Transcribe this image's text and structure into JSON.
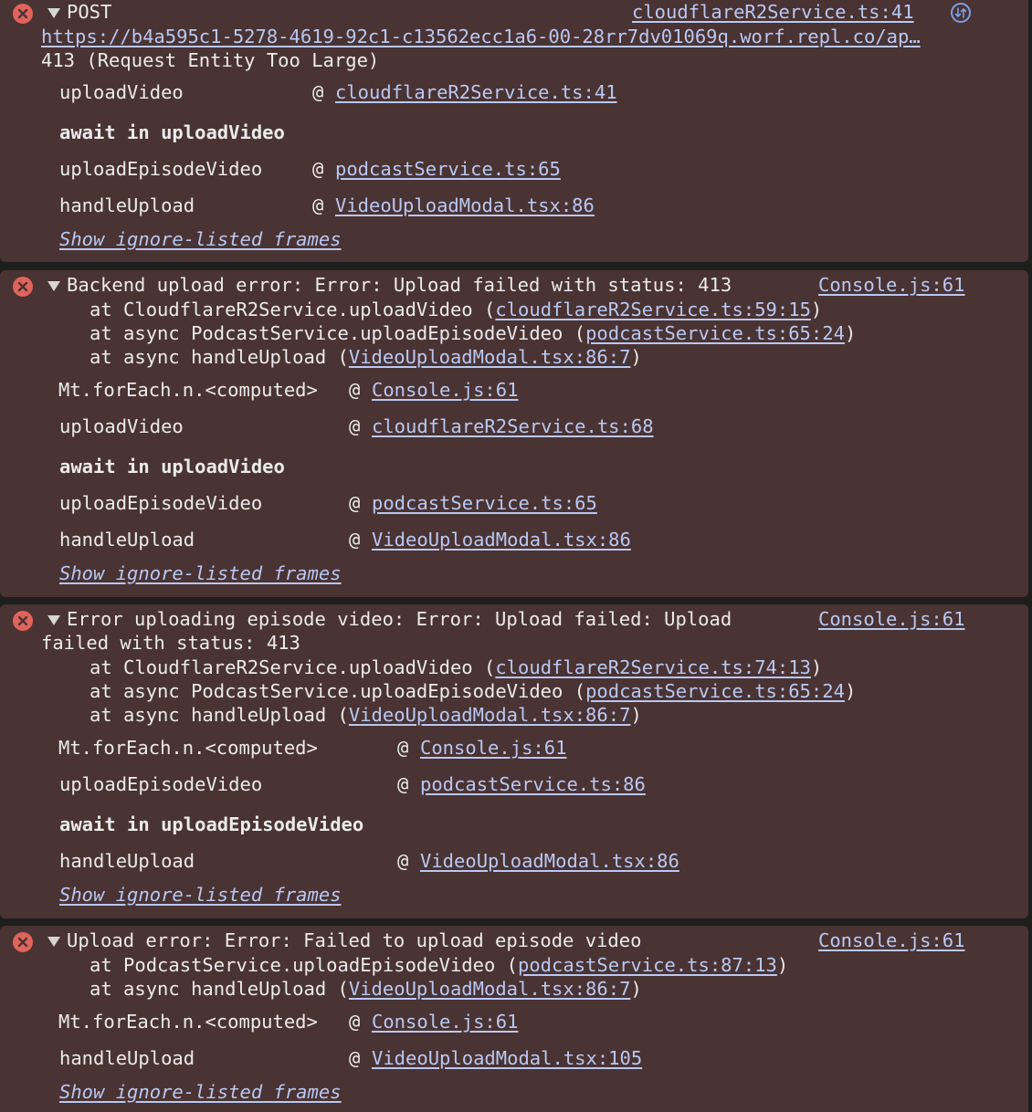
{
  "block1": {
    "method": "POST",
    "source": "cloudflareR2Service.ts:41",
    "url": "https://b4a595c1-5278-4619-92c1-c13562ecc1a6-00-28rr7dv01069q.worf.repl.co/ap…",
    "status": "413 (Request Entity Too Large)",
    "frames": [
      {
        "fn": "uploadVideo",
        "at": "@",
        "loc": "cloudflareR2Service.ts:41"
      },
      {
        "fn": "uploadEpisodeVideo",
        "at": "@",
        "loc": "podcastService.ts:65"
      },
      {
        "fn": "handleUpload",
        "at": "@",
        "loc": "VideoUploadModal.tsx:86"
      }
    ],
    "await_label": "await in uploadVideo",
    "show_frames": "Show ignore-listed frames"
  },
  "block2": {
    "message": "Backend upload error: Error: Upload failed with status: 413",
    "source": "Console.js:61",
    "stack": [
      {
        "prefix": "at CloudflareR2Service.uploadVideo (",
        "loc": "cloudflareR2Service.ts:59:15",
        "suffix": ")"
      },
      {
        "prefix": "at async PodcastService.uploadEpisodeVideo (",
        "loc": "podcastService.ts:65:24",
        "suffix": ")"
      },
      {
        "prefix": "at async handleUpload (",
        "loc": "VideoUploadModal.tsx:86:7",
        "suffix": ")"
      }
    ],
    "frames": [
      {
        "fn": "Mt.forEach.n.<computed>",
        "at": "@",
        "loc": "Console.js:61"
      },
      {
        "fn": "uploadVideo",
        "at": "@",
        "loc": "cloudflareR2Service.ts:68"
      },
      {
        "fn": "uploadEpisodeVideo",
        "at": "@",
        "loc": "podcastService.ts:65"
      },
      {
        "fn": "handleUpload",
        "at": "@",
        "loc": "VideoUploadModal.tsx:86"
      }
    ],
    "await_label": "await in uploadVideo",
    "show_frames": "Show ignore-listed frames"
  },
  "block3": {
    "message_line1": "Error uploading episode video: Error: Upload failed: Upload",
    "message_line2": "failed with status: 413",
    "source": "Console.js:61",
    "stack": [
      {
        "prefix": "at CloudflareR2Service.uploadVideo (",
        "loc": "cloudflareR2Service.ts:74:13",
        "suffix": ")"
      },
      {
        "prefix": "at async PodcastService.uploadEpisodeVideo (",
        "loc": "podcastService.ts:65:24",
        "suffix": ")"
      },
      {
        "prefix": "at async handleUpload (",
        "loc": "VideoUploadModal.tsx:86:7",
        "suffix": ")"
      }
    ],
    "frames": [
      {
        "fn": "Mt.forEach.n.<computed>",
        "at": "@",
        "loc": "Console.js:61"
      },
      {
        "fn": "uploadEpisodeVideo",
        "at": "@",
        "loc": "podcastService.ts:86"
      },
      {
        "fn": "handleUpload",
        "at": "@",
        "loc": "VideoUploadModal.tsx:86"
      }
    ],
    "await_label": "await in uploadEpisodeVideo",
    "show_frames": "Show ignore-listed frames"
  },
  "block4": {
    "message": "Upload error: Error: Failed to upload episode video",
    "source": "Console.js:61",
    "stack": [
      {
        "prefix": "at PodcastService.uploadEpisodeVideo (",
        "loc": "podcastService.ts:87:13",
        "suffix": ")"
      },
      {
        "prefix": "at async handleUpload (",
        "loc": "VideoUploadModal.tsx:86:7",
        "suffix": ")"
      }
    ],
    "frames": [
      {
        "fn": "Mt.forEach.n.<computed>",
        "at": "@",
        "loc": "Console.js:61"
      },
      {
        "fn": "handleUpload",
        "at": "@",
        "loc": "VideoUploadModal.tsx:105"
      }
    ],
    "show_frames": "Show ignore-listed frames"
  },
  "colors": {
    "error_background": "#4a3333",
    "link": "#b9c8f2",
    "error_icon": "#e0645c"
  }
}
